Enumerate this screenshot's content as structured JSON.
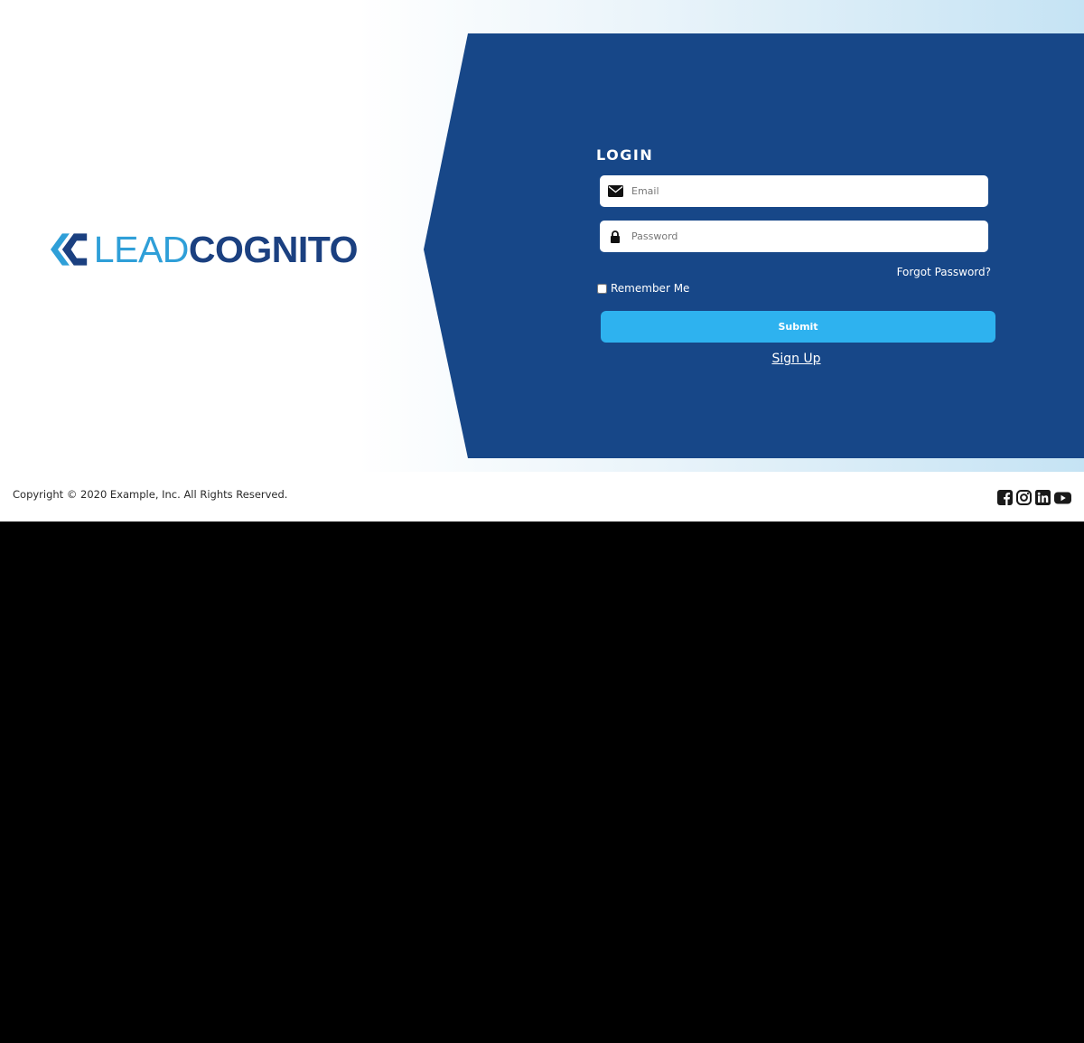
{
  "brand": {
    "name_part1": "LEAD",
    "name_part2": "COGNITO",
    "colors": {
      "light_blue": "#2f9fd8",
      "dark_blue": "#1b4080",
      "panel": "#174788",
      "button": "#2eb2ef"
    }
  },
  "login": {
    "title": "LOGIN",
    "email": {
      "placeholder": "Email",
      "value": "",
      "icon": "envelope-icon"
    },
    "password": {
      "placeholder": "Password",
      "value": "",
      "icon": "lock-icon"
    },
    "forgot_label": "Forgot Password?",
    "remember_label": "Remember Me",
    "remember_checked": false,
    "submit_label": "Submit",
    "signup_label": "Sign Up"
  },
  "footer": {
    "copyright": "Copyright © 2020 Example, Inc. All Rights Reserved.",
    "social": [
      "facebook-icon",
      "instagram-icon",
      "linkedin-icon",
      "youtube-icon"
    ]
  }
}
